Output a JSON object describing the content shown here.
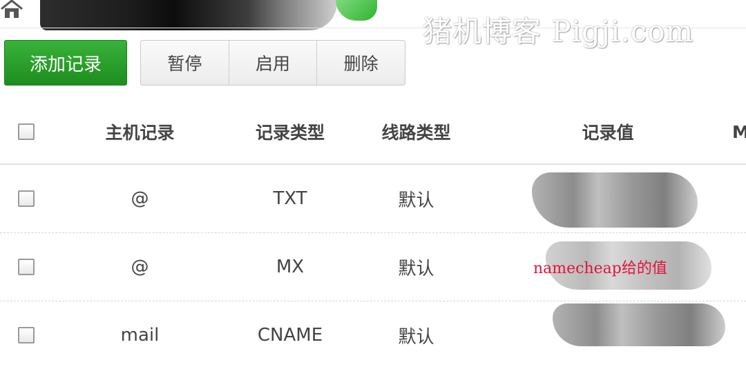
{
  "watermark": "猪机博客 Pigji.com",
  "toolbar": {
    "add_label": "添加记录",
    "pause_label": "暂停",
    "enable_label": "启用",
    "delete_label": "删除"
  },
  "table": {
    "headers": {
      "host": "主机记录",
      "type": "记录类型",
      "line": "线路类型",
      "value": "记录值",
      "next": "M"
    },
    "rows": [
      {
        "host": "@",
        "type": "TXT",
        "line": "默认",
        "value": ""
      },
      {
        "host": "@",
        "type": "MX",
        "line": "默认",
        "value": ""
      },
      {
        "host": "mail",
        "type": "CNAME",
        "line": "默认",
        "value": ""
      }
    ]
  },
  "annotation": "namecheap给的值",
  "colors": {
    "add_button": "#2aa12b",
    "annotation": "#e0143c"
  },
  "icons": {
    "home": "home-icon"
  }
}
